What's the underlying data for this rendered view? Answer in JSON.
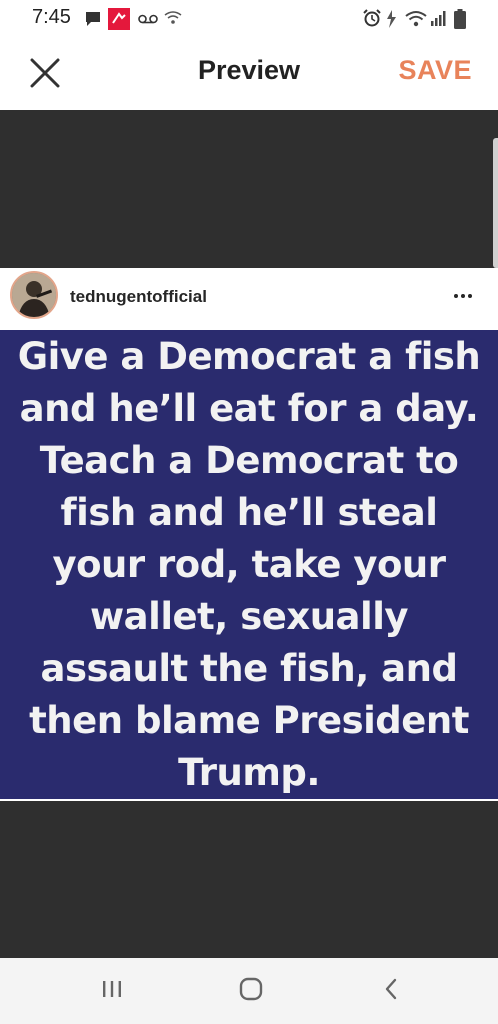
{
  "status_bar": {
    "time": "7:45"
  },
  "app_bar": {
    "title": "Preview",
    "save_label": "SAVE",
    "accent_color": "#e8835a"
  },
  "post": {
    "username": "tednugentofficial",
    "meme_lines": [
      "Give a Democrat a fish",
      "and he’ll eat for a day.",
      "Teach a Democrat to",
      "fish and he’ll steal",
      "your rod, take your",
      "wallet, sexually",
      "assault the fish, and",
      "then blame President",
      "Trump."
    ],
    "background_color": "#2a2b6e"
  },
  "icons": {
    "close": "close-icon",
    "more": "more-options-icon",
    "recents": "recents-icon",
    "home": "home-icon",
    "back": "back-icon"
  }
}
